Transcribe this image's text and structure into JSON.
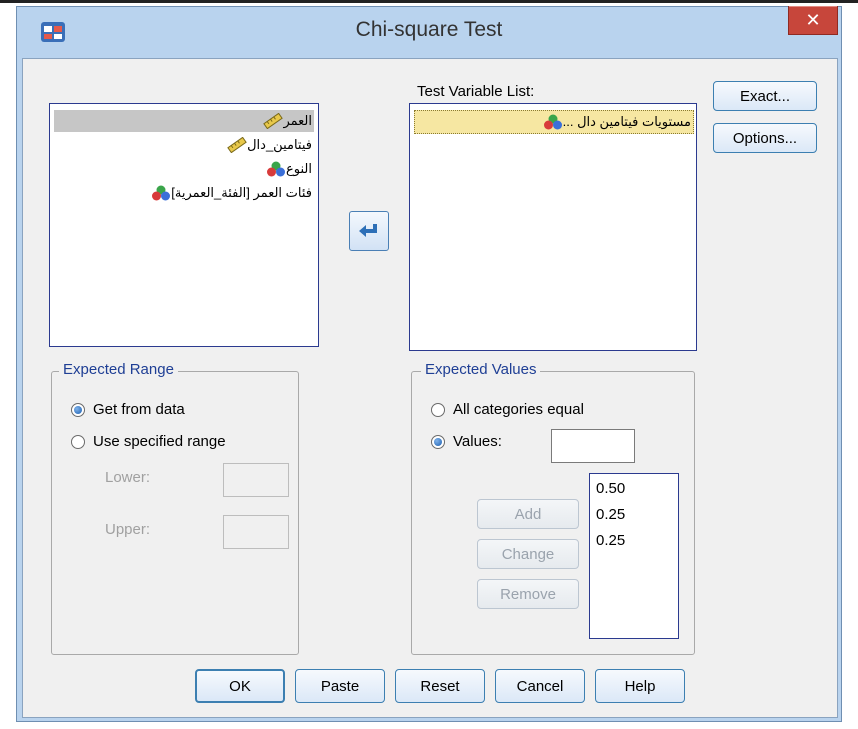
{
  "window": {
    "title": "Chi-square Test",
    "close_glyph": "✕"
  },
  "source_variables": [
    {
      "label": "العمر",
      "icon": "scale-ruler-icon",
      "selected": true
    },
    {
      "label": "فيتامين_دال",
      "icon": "scale-ruler-icon",
      "selected": false
    },
    {
      "label": "النوع",
      "icon": "nominal-circles-icon",
      "selected": false
    },
    {
      "label": "فئات العمر [الفئة_العمرية]",
      "icon": "nominal-circles-icon",
      "selected": false
    }
  ],
  "test_variable_list": {
    "label": "Test Variable List:",
    "items": [
      {
        "label": "مستويات فيتامين دال ...",
        "icon": "nominal-circles-icon"
      }
    ]
  },
  "side_buttons": {
    "exact": "Exact...",
    "options": "Options..."
  },
  "expected_range": {
    "title": "Expected Range",
    "get_from_data": "Get from data",
    "use_specified": "Use specified range",
    "lower": "Lower:",
    "upper": "Upper:",
    "selected": "get_from_data"
  },
  "expected_values": {
    "title": "Expected Values",
    "all_equal": "All categories equal",
    "values_label": "Values:",
    "values_input": "",
    "selected": "values",
    "add": "Add",
    "change": "Change",
    "remove": "Remove",
    "list": [
      "0.50",
      "0.25",
      "0.25"
    ]
  },
  "footer": {
    "ok": "OK",
    "paste": "Paste",
    "reset": "Reset",
    "cancel": "Cancel",
    "help": "Help"
  },
  "colors": {
    "frame": "#b9d3ee",
    "close": "#c7463b",
    "group_title": "#1f3f95",
    "selected_row": "#f6e7a2"
  }
}
